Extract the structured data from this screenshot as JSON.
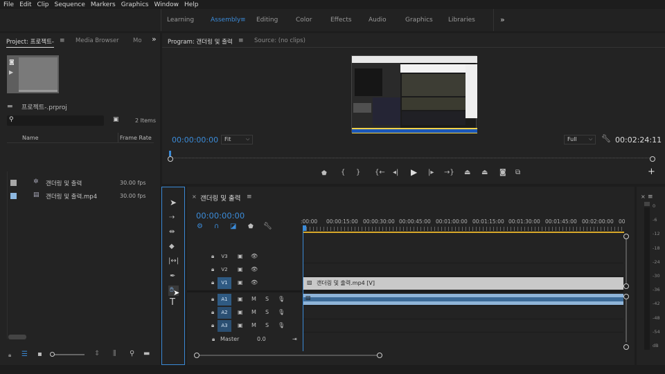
{
  "menu": [
    "File",
    "Edit",
    "Clip",
    "Sequence",
    "Markers",
    "Graphics",
    "Window",
    "Help"
  ],
  "workspaces": [
    {
      "label": "Learning",
      "active": false
    },
    {
      "label": "Assembly",
      "active": true
    },
    {
      "label": "Editing",
      "active": false
    },
    {
      "label": "Color",
      "active": false
    },
    {
      "label": "Effects",
      "active": false
    },
    {
      "label": "Audio",
      "active": false
    },
    {
      "label": "Graphics",
      "active": false
    },
    {
      "label": "Libraries",
      "active": false
    }
  ],
  "workspace_overflow": "»",
  "project": {
    "tabs": [
      "Project: 프로젝트-",
      "Media Browser",
      "Mo"
    ],
    "file_name": "프로젝트-.prproj",
    "items_count": "2 Items",
    "columns": {
      "name": "Name",
      "frame_rate": "Frame Rate"
    },
    "items": [
      {
        "name": "갠더링 및 출력",
        "fps": "30.00 fps",
        "color": "#a8a8a8",
        "kind": "sequence"
      },
      {
        "name": "갠더링 및 출력.mp4",
        "fps": "30.00 fps",
        "color": "#8db8e0",
        "kind": "clip"
      }
    ]
  },
  "program": {
    "tabs": [
      "Program: 갠더링 및 출력",
      "Source: (no clips)"
    ],
    "timecode": "00:00:00:00",
    "fit": "Fit",
    "quality": "Full",
    "duration": "00:02:24:11"
  },
  "timeline": {
    "title": "갠더링 및 출력",
    "timecode": "00:00:00:00",
    "ruler": [
      ":00:00",
      "00:00:15:00",
      "00:00:30:00",
      "00:00:45:00",
      "00:01:00:00",
      "00:01:15:00",
      "00:01:30:00",
      "00:01:45:00",
      "00:02:00:00",
      "00"
    ],
    "video_tracks": [
      "V3",
      "V2",
      "V1"
    ],
    "audio_tracks": [
      "A1",
      "A2",
      "A3"
    ],
    "master_label": "Master",
    "master_value": "0.0",
    "clip_label": "갠더링 및 출력.mp4 [V]",
    "m_label": "M",
    "s_label": "S"
  },
  "vu_meter": {
    "labels": [
      "0",
      "-6",
      "-12",
      "-18",
      "-24",
      "-30",
      "-36",
      "-42",
      "-48",
      "-54",
      "dB"
    ]
  },
  "colors": {
    "accent": "#3b8bd8",
    "clip_video": "#c9c9c9",
    "clip_audio": "#8fb4d8"
  }
}
